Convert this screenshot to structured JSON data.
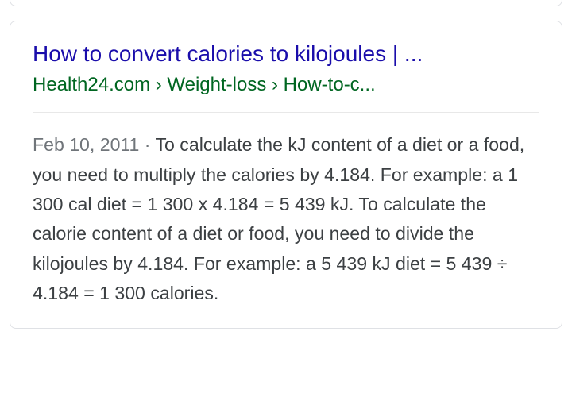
{
  "result": {
    "title": "How to convert calories to kilojoules | ...",
    "url_display": "Health24.com › Weight-loss › How-to-c...",
    "date": "Feb 10, 2011",
    "separator": " · ",
    "snippet": "To calculate the kJ content of a diet or a food, you need to multiply the calories by 4.184. For example: a 1 300 cal diet = 1 300 x 4.184 = 5 439 kJ. To calculate the calorie content of a diet or food, you need to divide the kilojoules by 4.184. For example: a 5 439 kJ diet = 5 439 ÷ 4.184 = 1 300 calories."
  }
}
